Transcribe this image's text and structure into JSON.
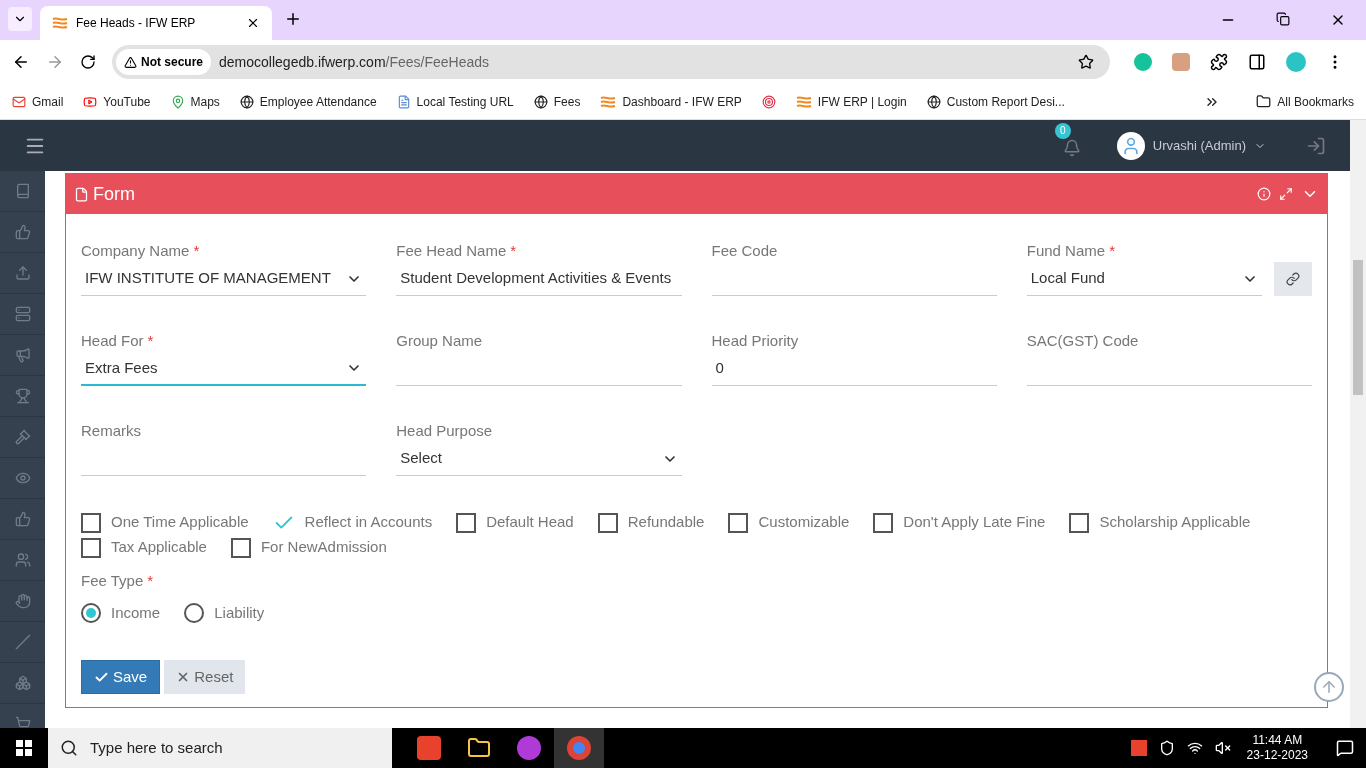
{
  "browser": {
    "tab_title": "Fee Heads - IFW ERP",
    "not_secure": "Not secure",
    "url_host": "democollegedb.ifwerp.com",
    "url_path": "/Fees/FeeHeads",
    "bookmarks": [
      {
        "kind": "labeled",
        "label": "Gmail"
      },
      {
        "kind": "labeled",
        "label": "YouTube"
      },
      {
        "kind": "labeled",
        "label": "Maps"
      },
      {
        "kind": "labeled",
        "label": "Employee Attendance"
      },
      {
        "kind": "labeled",
        "label": "Local Testing URL"
      },
      {
        "kind": "labeled",
        "label": "Fees"
      },
      {
        "kind": "labeled",
        "label": "Dashboard - IFW ERP"
      },
      {
        "kind": "icon_only"
      },
      {
        "kind": "labeled",
        "label": "IFW ERP | Login"
      },
      {
        "kind": "labeled",
        "label": "Custom Report Desi..."
      }
    ],
    "all_bookmarks": "All Bookmarks"
  },
  "header": {
    "notifications": "0",
    "user": "Urvashi (Admin)"
  },
  "form": {
    "title": "Form",
    "required_mark": "*",
    "fields": [
      {
        "label": "Company Name",
        "required": true,
        "kind": "select",
        "value": "IFW INSTITUTE OF MANAGEMENT",
        "focused": false
      },
      {
        "label": "Fee Head Name",
        "required": true,
        "kind": "text",
        "value": "Student Development Activities & Events",
        "focused": false
      },
      {
        "label": "Fee Code",
        "required": false,
        "kind": "text",
        "focused": false
      },
      {
        "label": "Fund Name",
        "required": true,
        "kind": "select_link",
        "value": "Local Fund",
        "focused": false
      },
      {
        "label": "Head For",
        "required": true,
        "kind": "select",
        "value": "Extra Fees",
        "focused": true
      },
      {
        "label": "Group Name",
        "required": false,
        "kind": "text",
        "focused": false
      },
      {
        "label": "Head Priority",
        "required": false,
        "kind": "text",
        "value": "0",
        "focused": false
      },
      {
        "label": "SAC(GST) Code",
        "required": false,
        "kind": "text",
        "focused": false
      },
      {
        "label": "Remarks",
        "required": false,
        "kind": "text",
        "focused": false
      },
      {
        "label": "Head Purpose",
        "required": false,
        "kind": "select",
        "value": "Select",
        "focused": false
      }
    ],
    "checkboxes": [
      {
        "label": "One Time Applicable",
        "checked": false
      },
      {
        "label": "Reflect in Accounts",
        "checked": true
      },
      {
        "label": "Default Head",
        "checked": false
      },
      {
        "label": "Refundable",
        "checked": false
      },
      {
        "label": "Customizable",
        "checked": false
      },
      {
        "label": "Don't Apply Late Fine",
        "checked": false
      },
      {
        "label": "Scholarship Applicable",
        "checked": false
      },
      {
        "label": "Tax Applicable",
        "checked": false
      },
      {
        "label": "For NewAdmission",
        "checked": false
      }
    ],
    "fee_type": {
      "label": "Fee Type",
      "required": true,
      "options": [
        {
          "label": "Income",
          "selected": true
        },
        {
          "label": "Liability",
          "selected": false
        }
      ]
    },
    "buttons": [
      {
        "label": "Save",
        "kind": "primary"
      },
      {
        "label": "Reset",
        "kind": "secondary"
      }
    ]
  },
  "taskbar": {
    "search_placeholder": "Type here to search",
    "time": "11:44 AM",
    "date": "23-12-2023"
  }
}
